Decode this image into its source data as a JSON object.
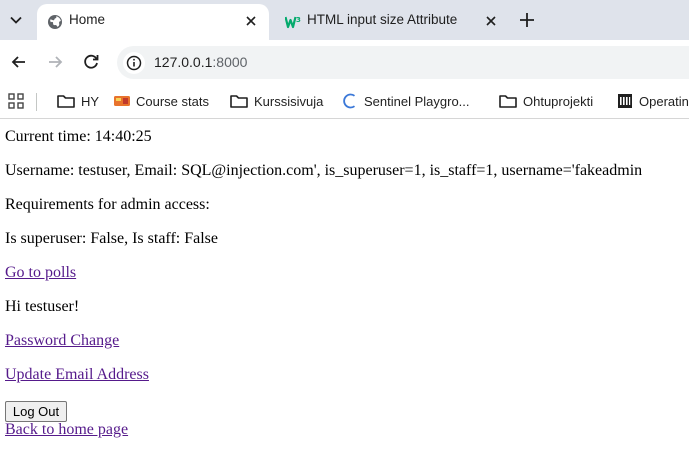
{
  "browser": {
    "tabs": [
      {
        "title": "Home",
        "icon": "globe-icon"
      },
      {
        "title": "HTML input size Attribute",
        "icon": "w3schools-icon"
      }
    ],
    "url": {
      "host": "127.0.0.1",
      "port": ":8000"
    },
    "bookmarks": [
      {
        "label": "HY",
        "icon": "folder-icon"
      },
      {
        "label": "Course stats",
        "icon": "course-stats-icon"
      },
      {
        "label": "Kurssisivuja",
        "icon": "folder-icon"
      },
      {
        "label": "Sentinel Playgro...",
        "icon": "sentinel-icon"
      },
      {
        "label": "Ohtuprojekti",
        "icon": "folder-icon"
      },
      {
        "label": "Operatin",
        "icon": "institution-icon"
      }
    ]
  },
  "page": {
    "current_time": "Current time: 14:40:25",
    "user_info": "Username: testuser, Email: SQL@injection.com', is_superuser=1, is_staff=1, username='fakeadmin",
    "requirements": "Requirements for admin access:",
    "superuser_status": "Is superuser: False, Is staff: False",
    "polls_link": "Go to polls",
    "greeting": "Hi testuser!",
    "password_change_link": "Password Change",
    "update_email_link": "Update Email Address",
    "logout_button": "Log Out",
    "back_home_link": "Back to home page"
  },
  "colors": {
    "link_visited": "#551a8b",
    "tabstrip_bg": "#dfe3eb",
    "omnibox_bg": "#f1f3f4"
  }
}
